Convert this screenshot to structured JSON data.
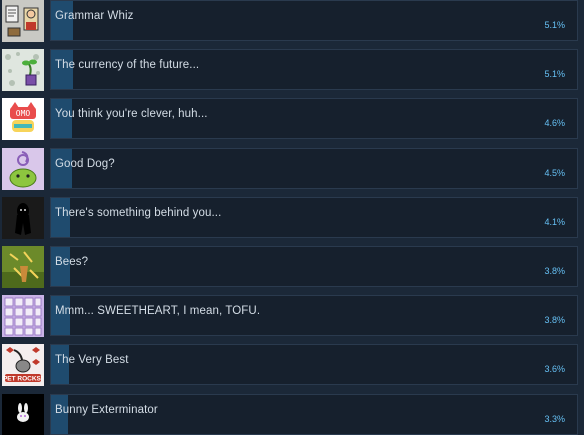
{
  "achievements": [
    {
      "name": "Grammar Whiz",
      "percent_label": "5.1%",
      "percent": 5.1,
      "icon": "grammar-whiz-icon",
      "icon_bg": "#c9c9c4"
    },
    {
      "name": "The currency of the future...",
      "percent_label": "5.1%",
      "percent": 5.1,
      "icon": "currency-icon",
      "icon_bg": "#dfe6df"
    },
    {
      "name": "You think you're clever, huh...",
      "percent_label": "4.6%",
      "percent": 4.6,
      "icon": "clever-cat-icon",
      "icon_bg": "#ffffff"
    },
    {
      "name": "Good Dog?",
      "percent_label": "4.5%",
      "percent": 4.5,
      "icon": "good-dog-icon",
      "icon_bg": "#d9c7ea"
    },
    {
      "name": "There's something behind you...",
      "percent_label": "4.1%",
      "percent": 4.1,
      "icon": "shadow-figure-icon",
      "icon_bg": "#1a1a1a"
    },
    {
      "name": "Bees?",
      "percent_label": "3.8%",
      "percent": 3.8,
      "icon": "bees-icon",
      "icon_bg": "#6c8a2a"
    },
    {
      "name": "Mmm... SWEETHEART, I mean, TOFU.",
      "percent_label": "3.8%",
      "percent": 3.8,
      "icon": "tofu-icon",
      "icon_bg": "#c9b3e6"
    },
    {
      "name": "The Very Best",
      "percent_label": "3.6%",
      "percent": 3.6,
      "icon": "pet-rocks-icon",
      "icon_bg": "#f4eeee"
    },
    {
      "name": "Bunny Exterminator",
      "percent_label": "3.3%",
      "percent": 3.3,
      "icon": "bunny-icon",
      "icon_bg": "#000000"
    }
  ],
  "icon_texts": {
    "pet_rocks": "PET ROCKS!"
  },
  "colors": {
    "background": "#1b2838",
    "panel": "#16202d",
    "bar_fill": "#1f4b6e",
    "title_text": "#d4dde6",
    "percent_text": "#66c0f4"
  }
}
